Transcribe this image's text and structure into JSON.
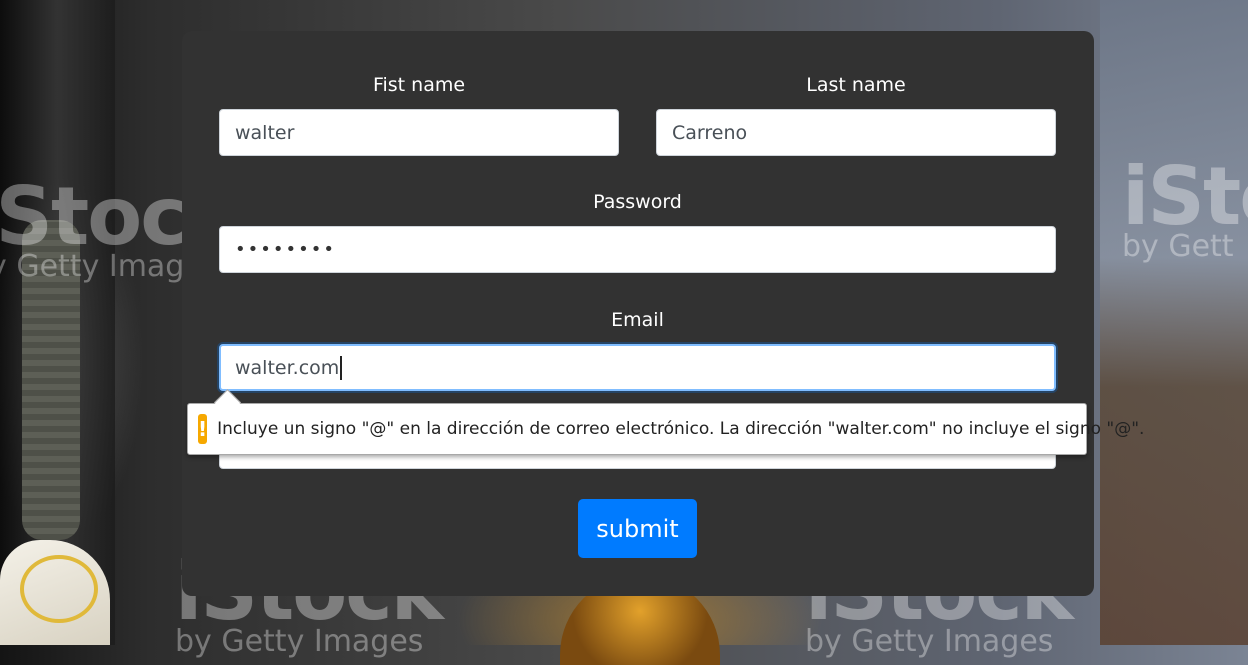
{
  "background": {
    "watermarks": [
      {
        "brand": "iStock",
        "sub": "by Getty Images"
      },
      {
        "brand": "iSto",
        "sub": "by Gett"
      },
      {
        "brand": "iStock",
        "sub": "by Getty Images"
      },
      {
        "brand": "iStock",
        "sub": "by Getty Images"
      }
    ]
  },
  "form": {
    "first_name": {
      "label": "Fist name",
      "value": "walter"
    },
    "last_name": {
      "label": "Last name",
      "value": "Carreno"
    },
    "password": {
      "label": "Password",
      "value": "••••••••"
    },
    "email": {
      "label": "Email",
      "value": "walter.com"
    },
    "validation": {
      "icon": "warning-icon",
      "icon_glyph": "!",
      "message": "Incluye un signo \"@\" en la dirección de correo electrónico. La dirección \"walter.com\" no incluye el signo \"@\"."
    },
    "submit_label": "submit"
  },
  "colors": {
    "card_bg": "#323232",
    "submit_bg": "#007bff",
    "warning": "#f6a800",
    "focus_border": "#80bdff"
  }
}
